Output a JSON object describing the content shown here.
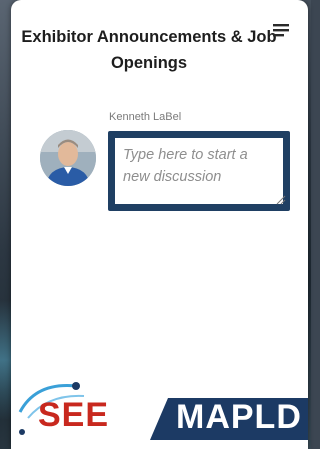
{
  "panel": {
    "title": "Exhibitor Announcements & Job Openings",
    "menu_icon": "list-menu-icon"
  },
  "compose": {
    "author_name": "Kenneth LaBel",
    "placeholder": "Type here to start a new discussion",
    "avatar_icon": "user-avatar",
    "resize_icon": "resize-grip-icon"
  },
  "branding": {
    "left_text": "SEE",
    "right_text": "MAPLD",
    "colors": {
      "see_red": "#c8281e",
      "mapld_blue": "#1c3a64",
      "compose_border": "#1f3f63"
    }
  }
}
